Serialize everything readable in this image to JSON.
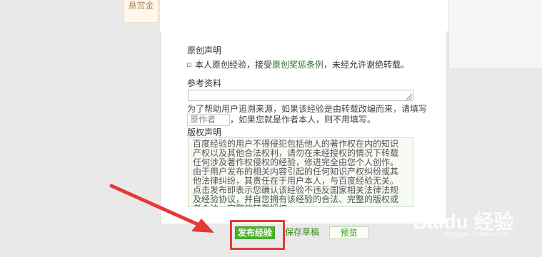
{
  "side_tab": {
    "label": "悬赏金"
  },
  "original": {
    "heading": "原创声明",
    "checkbox_text_a": "本人原创经验，接受",
    "checkbox_text_link": "原创奖惩条例",
    "checkbox_text_b": "，",
    "checkbox_text_c": "未经允许谢绝转载。"
  },
  "reference": {
    "heading": "参考资料",
    "hint_a": "为了帮助用户追溯来源，如果该经验是由转载改编而来，请填写",
    "source_placeholder": "原作者",
    "hint_b": "，如果您就是作者本人，则不用填写。"
  },
  "copyright": {
    "heading": "版权声明",
    "text": "百度经验的用户不得侵犯包括他人的著作权在内的知识产权以及其他合法权利，请勿在未经授权的情况下转载任何涉及著作权侵权的经验，修进完全由您个人创作。由于用户发布的相关内容引起的任何知识产权纠纷或其他法律纠纷，其责任在于用户本人，与百度经验无关。点击发布即表示您确认该经验不违反国家相关法律法规及经验协议，并自您拥有该经验的合法、完整的版权或者合法、完整的转载授权。"
  },
  "actions": {
    "publish": "发布经验",
    "save_draft": "保存草稿",
    "preview": "预览"
  },
  "watermark": {
    "brand": "Baidu 经验",
    "url": "jingyan.baidu.com"
  },
  "colors": {
    "accent_green": "#4db32f",
    "highlight_red": "#e53935"
  }
}
